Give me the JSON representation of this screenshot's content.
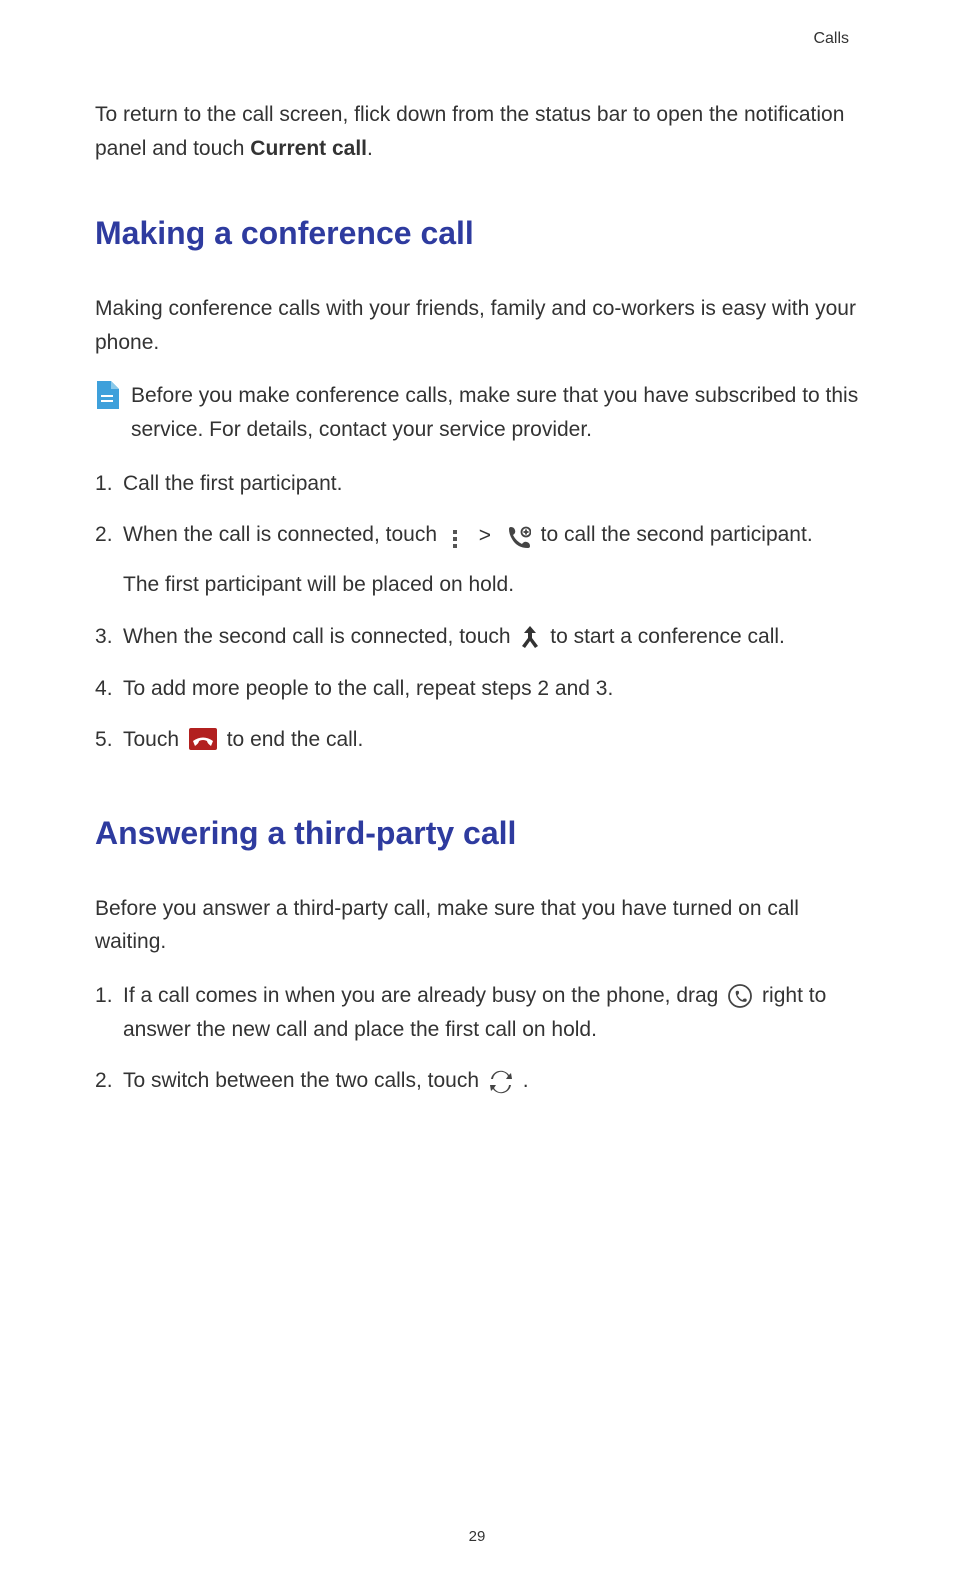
{
  "header": {
    "chapter": "Calls"
  },
  "intro": {
    "text_before_bold": "To return to the call screen, flick down from the status bar to open the notification panel and touch ",
    "bold_text": "Current call",
    "text_after_bold": "."
  },
  "section1": {
    "heading": "Making a conference call",
    "intro": "Making conference calls with your friends, family and co-workers is easy with your phone.",
    "note": "Before you make conference calls, make sure that you have subscribed to this service. For details, contact your service provider.",
    "step1": "Call the first participant.",
    "step2_a": "When the call is connected, touch ",
    "step2_chevron": ">",
    "step2_b": " to call the second participant.",
    "step2_sub": "The first participant will be placed on hold.",
    "step3_a": "When the second call is connected, touch ",
    "step3_b": " to start a conference call.",
    "step4": "To add more people to the call, repeat steps 2 and 3.",
    "step5_a": "Touch ",
    "step5_b": " to end the call."
  },
  "section2": {
    "heading": "Answering a third-party call",
    "intro": "Before you answer a third-party call, make sure that you have turned on call waiting.",
    "step1_a": "If a call comes in when you are already busy on the phone, drag ",
    "step1_b": " right to answer the new call and place the first call on hold.",
    "step2_a": "To switch between the two calls, touch ",
    "step2_b": " ."
  },
  "footer": {
    "page_number": "29"
  }
}
